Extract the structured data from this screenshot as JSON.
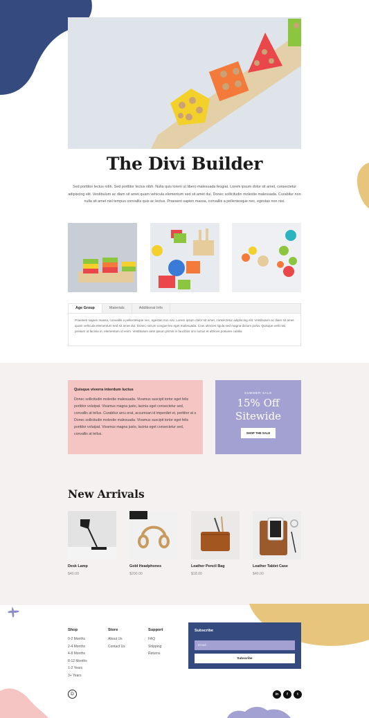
{
  "hero": {
    "title": "The Divi Builder",
    "intro": "Sed porttitor lectus nibh. Sed porttitor lectus nibh. Nulla quis lorem ut libero malesuada feugiat. Lorem ipsum dolor sit amet, consectetur adipiscing elit. Vestibulum ac diam sit amet quam vehicula elementum sed sit amet dui. Donec sollicitudin molestie malesuada. Curabitur non nulla sit amet nisl tempus convallis quis ac lectus. Praesent sapien massa, convallis a pellentesque nec, egestas non nisi."
  },
  "tabs": {
    "items": [
      {
        "label": "Age Group"
      },
      {
        "label": "Materials"
      },
      {
        "label": "Additional Info"
      }
    ],
    "body": "Praesent sapien massa, convallis a pellentesque nec, egestas non nisi. Lorem ipsum dolor sit amet, consectetur adipiscing elit. Vestibulum ac diam sit amet quam vehicula elementum sed sit amet dui. Donec rutrum congue leo eget malesuada. Cras ultricies ligula sed magna dictum porta. Quisque velit nisi, pretium ut lacinia in, elementum id enim. Vestibulum ante ipsum primis in faucibus orci luctus et ultrices posuere cubilia"
  },
  "promo": {
    "heading": "Quisque viverra interdum luctus",
    "body": "Donec sollicitudin molestie malesuada. Vivamus suscipit tortor eget felis porttitor volutpat. Vivamus magna justo, lacinia eget consectetur sed, convallis at tellus. Curabitur arcu erat, accumsan id imperdiet et, porttitor at s Donec sollicitudin molestie malesuada. Vivamus suscipit tortor eget felis porttitor volutpat. Vivamus magna justo, lacinia eget consectetur sed, convallis at tellus."
  },
  "sale": {
    "kicker": "SUMMER SALE",
    "line1": "15% Off",
    "line2": "Sitewide",
    "button": "SHOP THE SALE"
  },
  "arrivals": {
    "title": "New Arrivals",
    "products": [
      {
        "name": "Desk Lamp",
        "price": "$40.00"
      },
      {
        "name": "Gold Headphones",
        "price": "$200.00"
      },
      {
        "name": "Leather Pencil Bag",
        "price": "$18.00"
      },
      {
        "name": "Leather Tablet Case",
        "price": "$40.00"
      }
    ]
  },
  "footer": {
    "shop": {
      "title": "Shop",
      "links": [
        "0-2 Months",
        "2-4 Months",
        "4-8 Months",
        "8-12 Months",
        "1-2 Years",
        "3+ Years"
      ]
    },
    "store": {
      "title": "Store",
      "links": [
        "About Us",
        "Contact Us"
      ]
    },
    "support": {
      "title": "Support",
      "links": [
        "FAQ",
        "Shipping",
        "Returns"
      ]
    },
    "subscribe": {
      "title": "Subscribe",
      "placeholder": "Email",
      "button": "Subscribe"
    },
    "logo": "D",
    "social": [
      "in",
      "f",
      "t"
    ]
  },
  "colors": {
    "navy": "#354a7f",
    "mustard": "#e8c57c",
    "lavender": "#a3a1d2",
    "pink": "#f4c5c3",
    "section_bg": "#f6f1f1"
  }
}
